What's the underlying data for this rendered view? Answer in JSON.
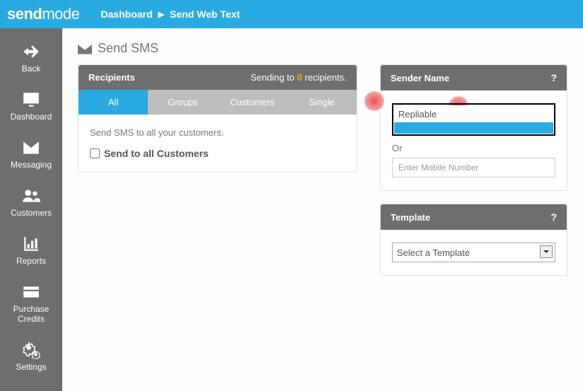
{
  "brand": {
    "part1": "send",
    "part2": "mode"
  },
  "breadcrumb": {
    "item1": "Dashboard",
    "item2": "Send Web Text"
  },
  "nav": {
    "back": "Back",
    "dashboard": "Dashboard",
    "messaging": "Messaging",
    "customers": "Customers",
    "reports": "Reports",
    "purchase": "Purchase Credits",
    "settings": "Settings"
  },
  "page": {
    "title": "Send SMS"
  },
  "recipients": {
    "header": "Recipients",
    "sending_prefix": "Sending to ",
    "count": "0",
    "sending_suffix": " recipients.",
    "tabs": {
      "all": "All",
      "groups": "Groups",
      "customers": "Customers",
      "single": "Single"
    },
    "hint": "Send SMS to all your customers.",
    "checkbox_label": "Send to all Customers"
  },
  "sender": {
    "header": "Sender Name",
    "selected": "Repliable",
    "or_label": "Or",
    "mobile_placeholder": "Enter Mobile Number"
  },
  "template": {
    "header": "Template",
    "placeholder": "Select a Template"
  },
  "help_glyph": "?"
}
